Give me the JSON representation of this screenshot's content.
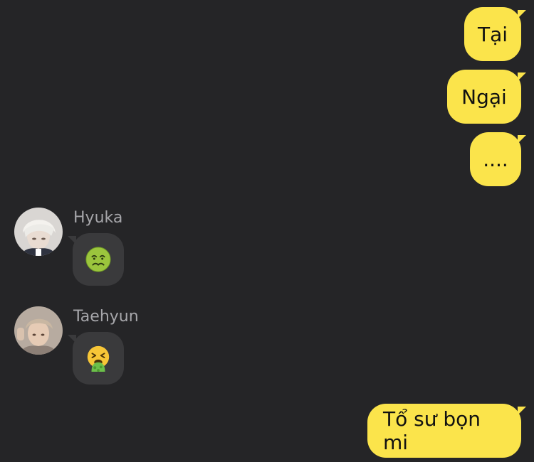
{
  "theme": {
    "background": "#252527",
    "outgoing_bubble": "#FBE44B",
    "incoming_bubble": "#3A3A3C",
    "sender_name_color": "#A6A6AA"
  },
  "messages": [
    {
      "direction": "outgoing",
      "text": "Tại"
    },
    {
      "direction": "outgoing",
      "text": "Ngại"
    },
    {
      "direction": "outgoing",
      "text": "...."
    },
    {
      "direction": "incoming",
      "sender": "Hyuka",
      "emoji": "nauseated-face"
    },
    {
      "direction": "incoming",
      "sender": "Taehyun",
      "emoji": "face-vomiting"
    },
    {
      "direction": "outgoing",
      "text": "Tổ sư bọn mi"
    }
  ]
}
